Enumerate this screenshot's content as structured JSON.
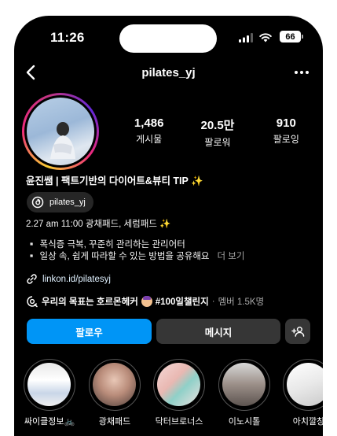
{
  "status_bar": {
    "time": "11:26",
    "battery": "66"
  },
  "nav": {
    "title": "pilates_yj"
  },
  "stats": [
    {
      "value": "1,486",
      "label": "게시물"
    },
    {
      "value": "20.5만",
      "label": "팔로워"
    },
    {
      "value": "910",
      "label": "팔로잉"
    }
  ],
  "bio": {
    "name": "윤진쌤 | 팩트기반의 다이어트&뷰티 TIP ✨",
    "threads_handle": "pilates_yj",
    "line1": "2.27 am 11:00 광채패드, 세럼패드 ✨",
    "line2": "▫️ 폭식증 극복, 꾸준히 관리하는 관리어터",
    "line3": "▫️ 일상 속, 쉽게 따라할 수 있는 방법을 공유해요",
    "more": "더 보기",
    "link": "linkon.id/pilatesyj"
  },
  "channel": {
    "name": "우리의 목표는 호르몬헤커",
    "tag": "#100일챌린지",
    "separator": "·",
    "members": "멤버 1.5K명"
  },
  "buttons": {
    "follow": "팔로우",
    "message": "메시지"
  },
  "highlights": [
    {
      "label": "싸이클정보🚲"
    },
    {
      "label": "광채패드"
    },
    {
      "label": "닥터브로너스"
    },
    {
      "label": "이노시톨"
    },
    {
      "label": "아치깔창"
    }
  ],
  "colors": {
    "accent": "#0095f6",
    "button_secondary": "#363636",
    "background": "#000000"
  }
}
